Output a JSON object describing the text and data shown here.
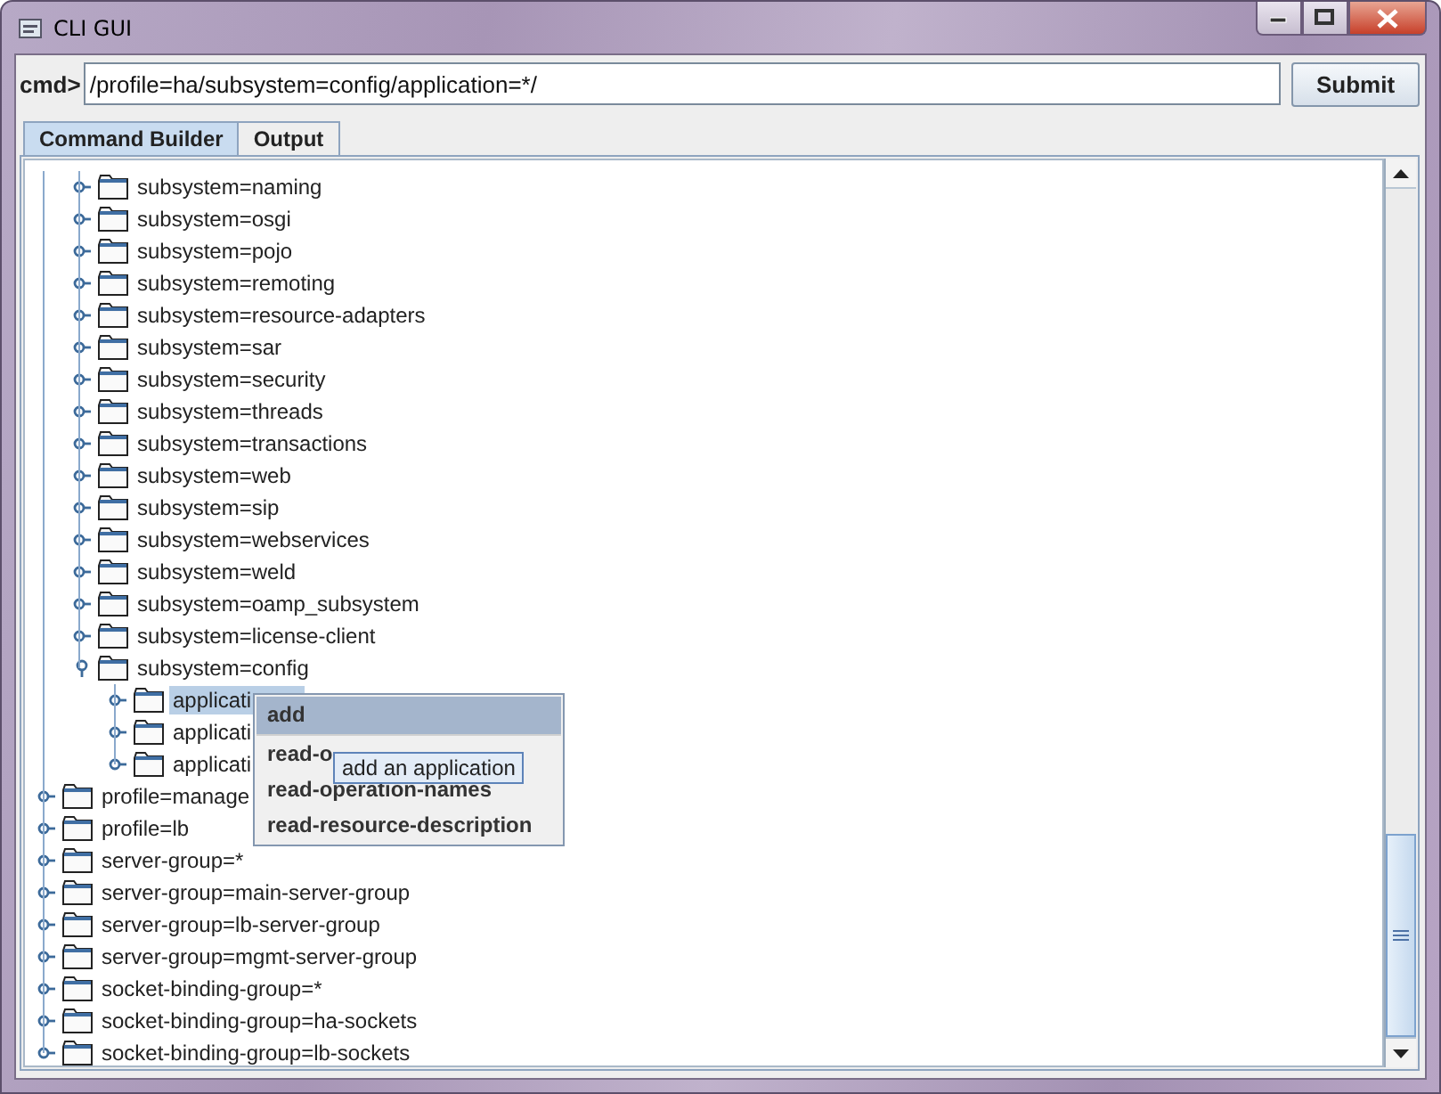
{
  "window": {
    "title": "CLI GUI"
  },
  "command": {
    "prompt": "cmd>",
    "value": "/profile=ha/subsystem=config/application=*/",
    "submit": "Submit"
  },
  "tabs": [
    {
      "label": "Command Builder",
      "selected": true
    },
    {
      "label": "Output",
      "selected": false
    }
  ],
  "tree": {
    "nodes": [
      {
        "children": [
          {
            "label": "subsystem=naming",
            "expanded": false,
            "selected": false
          },
          {
            "label": "subsystem=osgi",
            "expanded": false,
            "selected": false
          },
          {
            "label": "subsystem=pojo",
            "expanded": false,
            "selected": false
          },
          {
            "label": "subsystem=remoting",
            "expanded": false,
            "selected": false
          },
          {
            "label": "subsystem=resource-adapters",
            "expanded": false,
            "selected": false
          },
          {
            "label": "subsystem=sar",
            "expanded": false,
            "selected": false
          },
          {
            "label": "subsystem=security",
            "expanded": false,
            "selected": false
          },
          {
            "label": "subsystem=threads",
            "expanded": false,
            "selected": false
          },
          {
            "label": "subsystem=transactions",
            "expanded": false,
            "selected": false
          },
          {
            "label": "subsystem=web",
            "expanded": false,
            "selected": false
          },
          {
            "label": "subsystem=sip",
            "expanded": false,
            "selected": false
          },
          {
            "label": "subsystem=webservices",
            "expanded": false,
            "selected": false
          },
          {
            "label": "subsystem=weld",
            "expanded": false,
            "selected": false
          },
          {
            "label": "subsystem=oamp_subsystem",
            "expanded": false,
            "selected": false
          },
          {
            "label": "subsystem=license-client",
            "expanded": false,
            "selected": false
          },
          {
            "label": "subsystem=config",
            "expanded": true,
            "selected": false,
            "children": [
              {
                "label": "applicati",
                "expanded": false,
                "selected": true
              },
              {
                "label": "applicati",
                "expanded": false,
                "selected": false
              },
              {
                "label": "applicati",
                "expanded": false,
                "selected": false
              }
            ]
          }
        ]
      },
      {
        "label": "profile=manage",
        "expanded": false,
        "selected": false
      },
      {
        "label": "profile=lb",
        "expanded": false,
        "selected": false
      },
      {
        "label": "server-group=*",
        "expanded": false,
        "selected": false
      },
      {
        "label": "server-group=main-server-group",
        "expanded": false,
        "selected": false
      },
      {
        "label": "server-group=lb-server-group",
        "expanded": false,
        "selected": false
      },
      {
        "label": "server-group=mgmt-server-group",
        "expanded": false,
        "selected": false
      },
      {
        "label": "socket-binding-group=*",
        "expanded": false,
        "selected": false
      },
      {
        "label": "socket-binding-group=ha-sockets",
        "expanded": false,
        "selected": false
      },
      {
        "label": "socket-binding-group=lb-sockets",
        "expanded": false,
        "selected": false
      }
    ]
  },
  "context_menu": {
    "items": [
      {
        "label": "add",
        "selected": true
      },
      {
        "label": "read-o",
        "selected": false
      },
      {
        "label": "read-operation-names",
        "selected": false
      },
      {
        "label": "read-resource-description",
        "selected": false
      }
    ],
    "tooltip": "add an application"
  }
}
